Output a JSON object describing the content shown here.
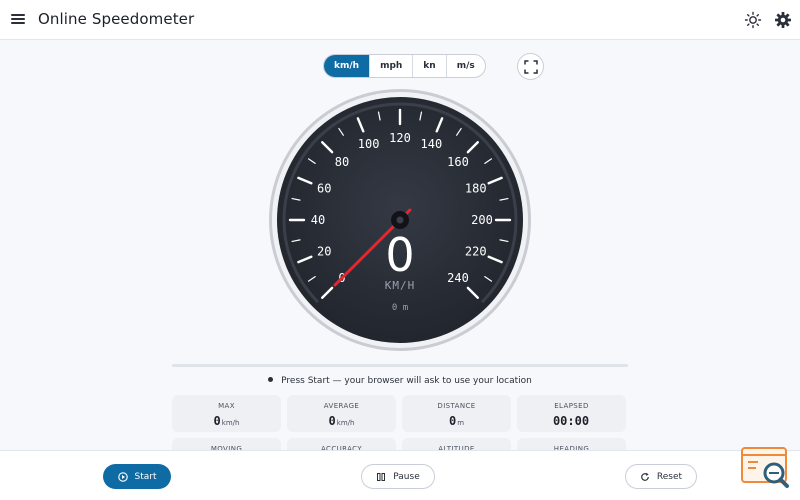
{
  "header": {
    "title": "Online Speedometer",
    "menu_icon": "hamburger-menu-icon",
    "theme_icon": "sun-icon",
    "settings_icon": "gear-icon"
  },
  "units": [
    {
      "label": "km/h",
      "active": true
    },
    {
      "label": "mph",
      "active": false
    },
    {
      "label": "kn",
      "active": false
    },
    {
      "label": "m/s",
      "active": false
    }
  ],
  "fullscreen_icon": "fullscreen-icon",
  "gauge": {
    "min": 0,
    "max": 240,
    "step": 20,
    "labels": [
      "0",
      "20",
      "40",
      "60",
      "80",
      "100",
      "120",
      "140",
      "160",
      "180",
      "200",
      "220",
      "240"
    ],
    "speed": "0",
    "speed_value": 0,
    "unit": "KM/H",
    "distance": "0 m",
    "colors": {
      "face": "#262a32",
      "needle": "#e3262f",
      "ticks": "#ffffff"
    }
  },
  "status": "Press Start — your browser will ask to use your location",
  "stats": [
    {
      "label": "MAX",
      "value": "0",
      "unit": "km/h"
    },
    {
      "label": "AVERAGE",
      "value": "0",
      "unit": "km/h"
    },
    {
      "label": "DISTANCE",
      "value": "0",
      "unit": "m"
    },
    {
      "label": "ELAPSED",
      "value": "00:00",
      "unit": ""
    },
    {
      "label": "MOVING",
      "value": "",
      "unit": ""
    },
    {
      "label": "ACCURACY",
      "value": "",
      "unit": ""
    },
    {
      "label": "ALTITUDE",
      "value": "",
      "unit": ""
    },
    {
      "label": "HEADING",
      "value": "",
      "unit": ""
    }
  ],
  "footer": {
    "start": "Start",
    "pause": "Pause",
    "reset": "Reset"
  },
  "accent_color": "#0f6ba3"
}
